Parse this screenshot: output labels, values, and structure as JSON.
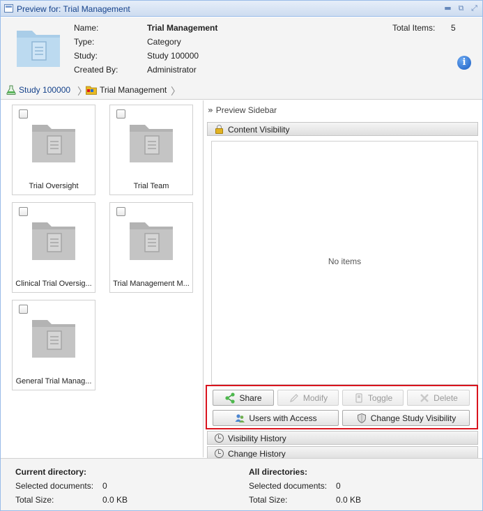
{
  "window": {
    "title": "Preview for: Trial Management"
  },
  "header": {
    "fields": [
      {
        "label": "Name:",
        "value": "Trial Management"
      },
      {
        "label": "Type:",
        "value": "Category"
      },
      {
        "label": "Study:",
        "value": "Study 100000"
      },
      {
        "label": "Created By:",
        "value": "Administrator"
      }
    ],
    "total_label": "Total Items:",
    "total_value": "5"
  },
  "breadcrumb": {
    "items": [
      "Study 100000",
      "Trial Management"
    ]
  },
  "tiles": [
    {
      "label": "Trial Oversight"
    },
    {
      "label": "Trial Team"
    },
    {
      "label": "Clinical Trial Oversig..."
    },
    {
      "label": "Trial Management M..."
    },
    {
      "label": "General Trial Manag..."
    }
  ],
  "sidebar": {
    "title": "Preview Sidebar",
    "panels": {
      "content_visibility": "Content Visibility",
      "visibility_history": "Visibility History",
      "change_history": "Change History"
    },
    "empty_message": "No items",
    "buttons": {
      "share": "Share",
      "modify": "Modify",
      "toggle": "Toggle",
      "delete": "Delete",
      "users_with_access": "Users with Access",
      "change_study_visibility": "Change Study Visibility"
    }
  },
  "footer": {
    "current": {
      "heading": "Current directory:",
      "selected_label": "Selected documents:",
      "selected_value": "0",
      "size_label": "Total Size:",
      "size_value": "0.0 KB"
    },
    "all": {
      "heading": "All directories:",
      "selected_label": "Selected documents:",
      "selected_value": "0",
      "size_label": "Total Size:",
      "size_value": "0.0 KB"
    }
  },
  "colors": {
    "title_text": "#15428b",
    "highlight_border": "#d9141e",
    "folder_big": "#a9cde8",
    "folder_tile": "#b3b3b3"
  }
}
